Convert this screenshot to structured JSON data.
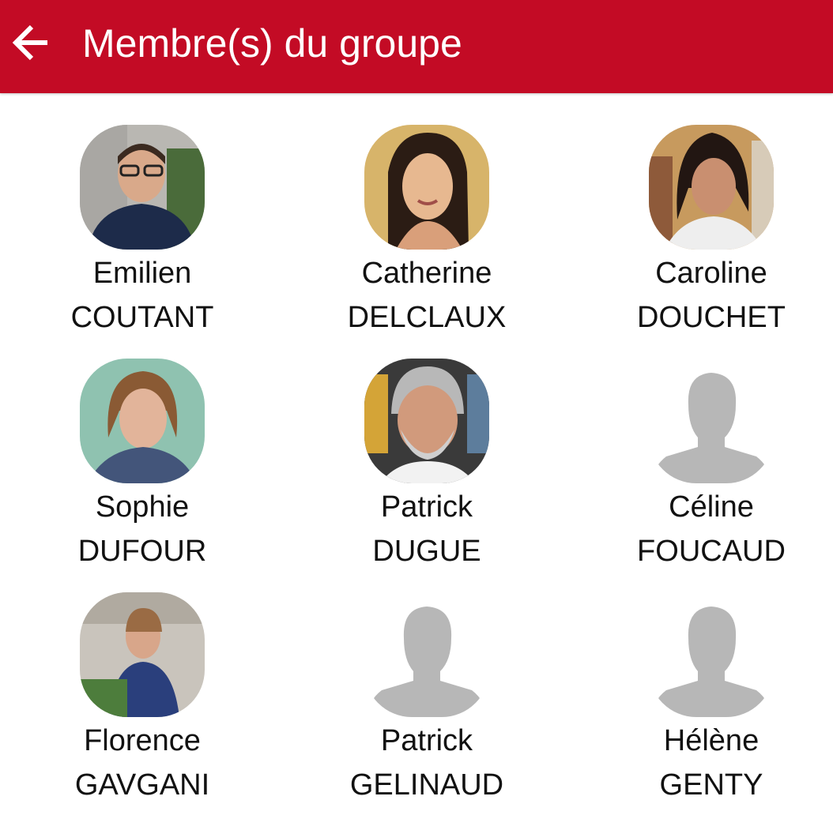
{
  "header": {
    "title": "Membre(s) du groupe",
    "back_icon": "arrow-back-icon",
    "background": "#c30b25"
  },
  "members": [
    {
      "first": "Emilien",
      "last": "COUTANT",
      "avatar": "photo"
    },
    {
      "first": "Catherine",
      "last": "DELCLAUX",
      "avatar": "photo"
    },
    {
      "first": "Caroline",
      "last": "DOUCHET",
      "avatar": "photo"
    },
    {
      "first": "Sophie",
      "last": "DUFOUR",
      "avatar": "photo"
    },
    {
      "first": "Patrick",
      "last": "DUGUE",
      "avatar": "photo"
    },
    {
      "first": "Céline",
      "last": "FOUCAUD",
      "avatar": "default-silhouette"
    },
    {
      "first": "Florence",
      "last": "GAVGANI",
      "avatar": "photo"
    },
    {
      "first": "Patrick",
      "last": "GELINAUD",
      "avatar": "default-silhouette"
    },
    {
      "first": "Hélène",
      "last": "GENTY",
      "avatar": "default-silhouette"
    }
  ]
}
